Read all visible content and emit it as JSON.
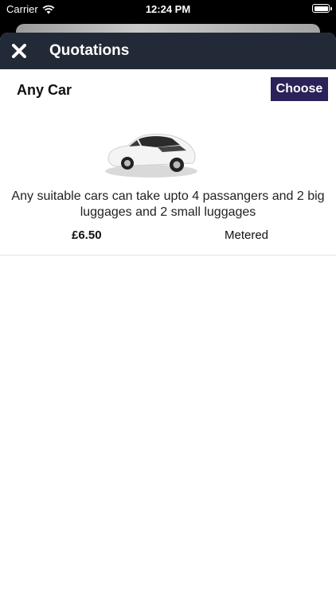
{
  "status_bar": {
    "carrier": "Carrier",
    "time": "12:24 PM",
    "icons": [
      "wifi-icon",
      "battery-icon"
    ]
  },
  "nav": {
    "title": "Quotations",
    "close_icon": "close-icon"
  },
  "quotes": [
    {
      "name": "Any Car",
      "choose_label": "Choose",
      "description": "Any suitable cars can take upto 4 passangers and 2 big luggages and 2 small luggages",
      "price": "£6.50",
      "fare_type": "Metered"
    }
  ],
  "colors": {
    "nav_bg": "#222a37",
    "button_bg": "#2a2258",
    "background": "#ffffff"
  }
}
